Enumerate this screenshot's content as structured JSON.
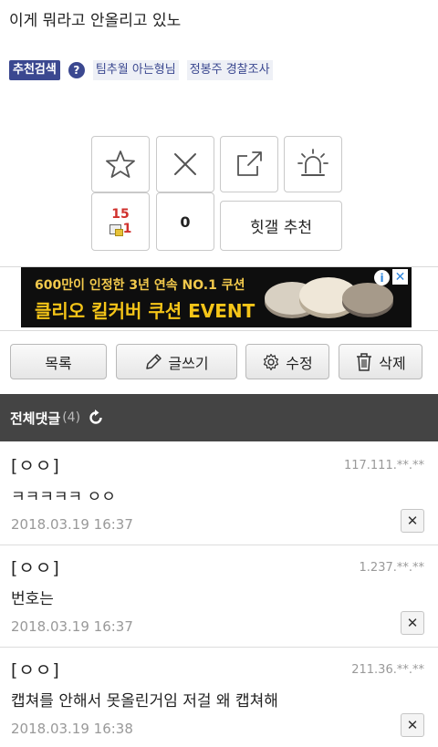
{
  "post": {
    "title": "이게 뭐라고 안올리고 있노"
  },
  "recommend_search": {
    "label": "추천검색",
    "help_icon": "question-circle-icon",
    "help_glyph": "?",
    "tags": [
      "팀추월 아는형님",
      "정봉주 경찰조사"
    ]
  },
  "vote": {
    "recommend_icon": "star-icon",
    "not_recommend_icon": "x-icon",
    "share_icon": "share-icon",
    "report_icon": "siren-icon",
    "recommend_count": "15",
    "fixed_recommend_count": "1",
    "not_recommend_count": "0",
    "hit_gallery_label": "힛갤 추천"
  },
  "ad": {
    "line1": "600만이 인정한 3년 연속 NO.1 쿠션",
    "line2": "클리오 킬커버 쿠션 EVENT",
    "info_glyph": "i",
    "close_glyph": "✕"
  },
  "actions": {
    "list_label": "목록",
    "write_label": "글쓰기",
    "edit_label": "수정",
    "delete_label": "삭제",
    "write_icon": "pencil-icon",
    "edit_icon": "gear-icon",
    "delete_icon": "trash-icon"
  },
  "comments": {
    "title": "전체댓글",
    "count": "(4)",
    "refresh_icon": "refresh-icon",
    "delete_glyph": "✕",
    "items": [
      {
        "author": "[ㅇㅇ]",
        "ip": "117.111.**.**",
        "text": "ㅋㅋㅋㅋㅋ ㅇㅇ",
        "date": "2018.03.19 16:37"
      },
      {
        "author": "[ㅇㅇ]",
        "ip": "1.237.**.**",
        "text": "번호는",
        "date": "2018.03.19 16:37"
      },
      {
        "author": "[ㅇㅇ]",
        "ip": "211.36.**.**",
        "text": "캡쳐를 안해서 못올린거임 저걸 왜 캡쳐해",
        "date": "2018.03.19 16:38"
      }
    ]
  },
  "colors": {
    "accent": "#3b4890",
    "count_red": "#d0312d",
    "comments_bar": "#444444",
    "ad_text": "#f5c518"
  }
}
